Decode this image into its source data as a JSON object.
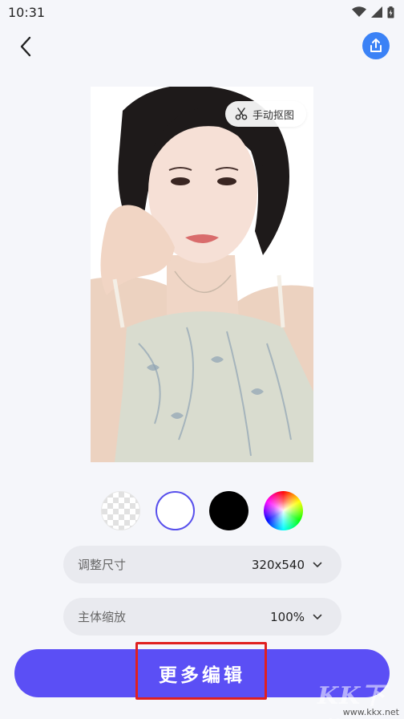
{
  "status_bar": {
    "time": "10:31",
    "icons": [
      "wifi-icon",
      "signal-icon",
      "battery-icon"
    ]
  },
  "header": {
    "back_icon": "chevron-left-icon",
    "share_icon": "share-icon",
    "share_color": "#3b82f6"
  },
  "preview": {
    "image_description_icon": "portrait-photo",
    "manual_cutout_label": "手动抠图",
    "manual_cutout_icon": "scissors-icon"
  },
  "background_options": {
    "items": [
      {
        "name": "transparent",
        "color": "checkerboard"
      },
      {
        "name": "white",
        "color": "#ffffff",
        "selected": true
      },
      {
        "name": "black",
        "color": "#000000"
      },
      {
        "name": "color-picker",
        "color": "rainbow"
      }
    ],
    "selected_border_color": "#5850ec"
  },
  "settings": {
    "size_label": "调整尺寸",
    "size_value": "320x540",
    "scale_label": "主体缩放",
    "scale_value": "100%"
  },
  "action": {
    "more_edit_label": "更多编辑",
    "button_color": "#5b4ff5"
  },
  "watermark": {
    "logo": "KK下载",
    "url": "www.kkx.net"
  }
}
